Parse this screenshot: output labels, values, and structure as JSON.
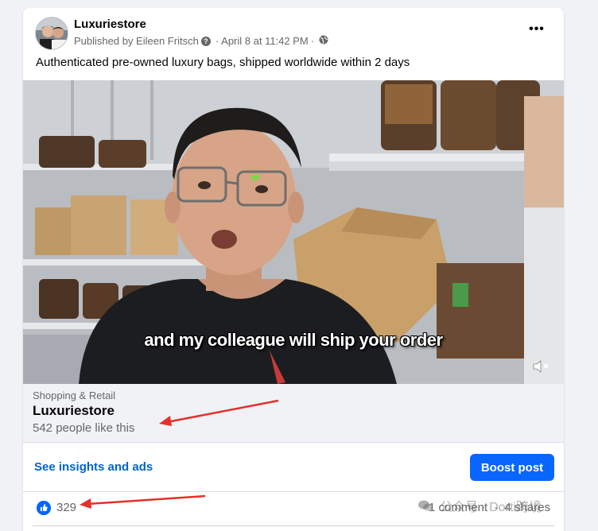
{
  "post": {
    "page_name": "Luxuriestore",
    "published_by": "Published by Eileen Fritsch",
    "date": "April 8 at 11:42 PM",
    "separator": "·",
    "question_glyph": "?",
    "more_glyph": "•••",
    "text": "Authenticated pre-owned luxury bags, shipped worldwide within 2 days"
  },
  "video": {
    "caption": "and my colleague will ship your order"
  },
  "page_info": {
    "category": "Shopping & Retail",
    "name": "Luxuriestore",
    "likes": "542 people like this"
  },
  "actions": {
    "insights": "See insights and ads",
    "boost": "Boost post"
  },
  "reactions": {
    "count": "329",
    "comments": "1 comment",
    "dot": "·",
    "shares": "4 shares"
  },
  "watermark": {
    "text": "公众号 · Dorti跨境"
  },
  "colors": {
    "accent": "#0866ff",
    "link": "#0064d1",
    "annotation_arrow": "#e5302a"
  }
}
